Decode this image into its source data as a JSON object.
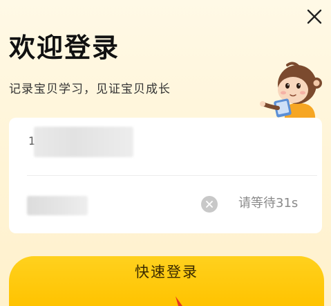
{
  "header": {
    "title": "欢迎登录",
    "subtitle": "记录宝贝学习，见证宝贝成长"
  },
  "icons": {
    "close": "close-icon",
    "mascot": "monkey-mascot-icon",
    "clear": "clear-circle-icon",
    "cursor": "cursor-arrow-icon"
  },
  "form": {
    "phone_prefix": "1",
    "phone_value": "",
    "code_value": "",
    "countdown_text": "请等待31s"
  },
  "actions": {
    "login_label": "快速登录"
  },
  "colors": {
    "background": "#FFF4D6",
    "accent": "#FFC300",
    "card": "#FFFFFF",
    "muted_text": "#8A8A8A"
  }
}
